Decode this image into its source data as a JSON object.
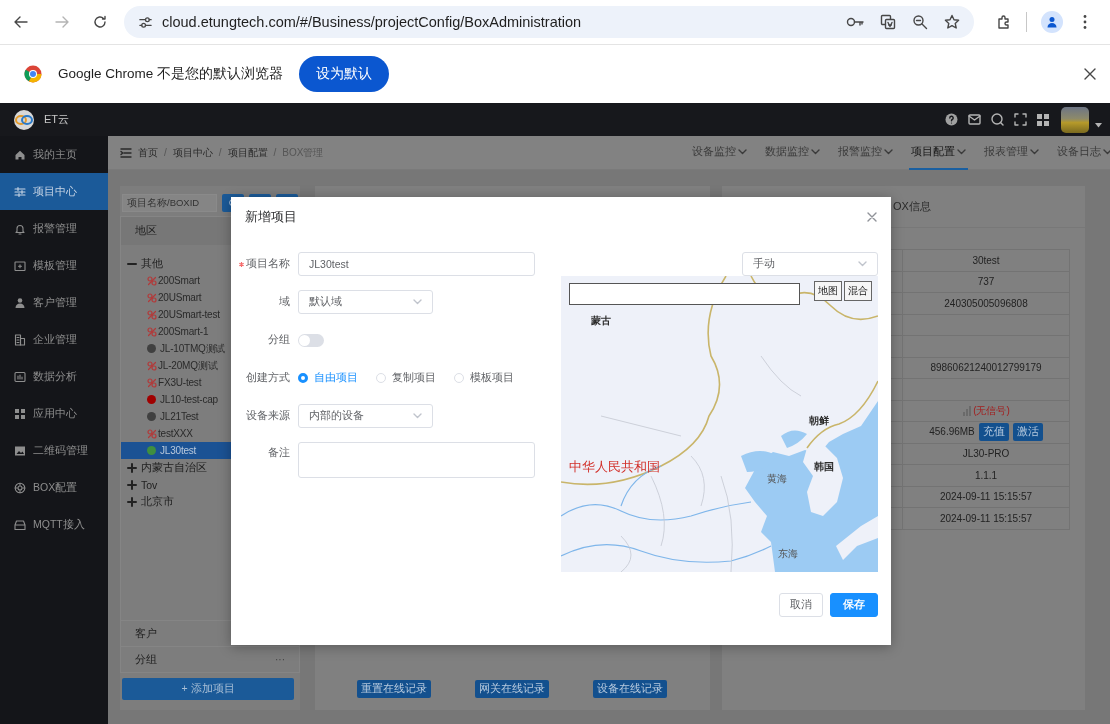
{
  "browser": {
    "url": "cloud.etungtech.com/#/Business/projectConfig/BoxAdministration",
    "forward_disabled": true
  },
  "infobar": {
    "message": "Google Chrome 不是您的默认浏览器",
    "button": "设为默认"
  },
  "app": {
    "logo_text": "ET云"
  },
  "sidebar": {
    "items": [
      {
        "label": "我的主页",
        "kind": "home",
        "selected": false
      },
      {
        "label": "项目中心",
        "kind": "sliders",
        "selected": true
      },
      {
        "label": "报警管理",
        "kind": "bell",
        "selected": false
      },
      {
        "label": "模板管理",
        "kind": "folder",
        "selected": false
      },
      {
        "label": "客户管理",
        "kind": "user",
        "selected": false
      },
      {
        "label": "企业管理",
        "kind": "building",
        "selected": false
      },
      {
        "label": "数据分析",
        "kind": "chart",
        "selected": false
      },
      {
        "label": "应用中心",
        "kind": "grid",
        "selected": false
      },
      {
        "label": "二维码管理",
        "kind": "image",
        "selected": false
      },
      {
        "label": "BOX配置",
        "kind": "gear",
        "selected": false
      },
      {
        "label": "MQTT接入",
        "kind": "tray",
        "selected": false
      }
    ]
  },
  "breadcrumb": {
    "separator": "/",
    "items": [
      "首页",
      "项目中心",
      "项目配置",
      "BOX管理"
    ]
  },
  "nav_tabs": [
    {
      "label": "设备监控",
      "selected": false
    },
    {
      "label": "数据监控",
      "selected": false
    },
    {
      "label": "报警监控",
      "selected": false
    },
    {
      "label": "项目配置",
      "selected": true
    },
    {
      "label": "报表管理",
      "selected": false
    },
    {
      "label": "设备日志",
      "selected": false
    }
  ],
  "tree_panel": {
    "search_placeholder": "项目名称/BOXID",
    "header": "地区",
    "tree": [
      {
        "label": "其他",
        "expanded": true,
        "selected": false,
        "children": [
          {
            "label": "200Smart",
            "kind": "link",
            "selected": false
          },
          {
            "label": "20USmart",
            "kind": "link",
            "selected": false
          },
          {
            "label": "20USmart-test",
            "kind": "link",
            "selected": false
          },
          {
            "label": "200Smart-1",
            "kind": "link",
            "selected": false
          },
          {
            "label": "JL-10TMQ测试",
            "kind": "dot",
            "color": "#404040",
            "selected": false
          },
          {
            "label": "JL-20MQ测试",
            "kind": "link",
            "selected": false
          },
          {
            "label": "FX3U-test",
            "kind": "link",
            "selected": false
          },
          {
            "label": "JL10-test-cap",
            "kind": "dot",
            "color": "#a00000",
            "selected": false
          },
          {
            "label": "JL21Test",
            "kind": "dot",
            "color": "#404040",
            "selected": false
          },
          {
            "label": "testXXX",
            "kind": "link",
            "selected": false
          },
          {
            "label": "JL30test",
            "kind": "dot",
            "color": "#3f8f3f",
            "selected": true
          }
        ]
      },
      {
        "label": "内蒙古自治区",
        "expanded": false,
        "selected": false
      },
      {
        "label": "Tov",
        "expanded": false,
        "selected": false
      },
      {
        "label": "北京市",
        "expanded": false,
        "selected": false
      }
    ],
    "footer_rows": [
      {
        "label": "客户"
      },
      {
        "label": "分组",
        "more": "···"
      }
    ],
    "add_button": "+ 添加项目"
  },
  "records_buttons": [
    "重置在线记录",
    "网关在线记录",
    "设备在线记录"
  ],
  "box_info": {
    "title": "OX信息",
    "rows": [
      {
        "kind": "text",
        "value": "30test"
      },
      {
        "kind": "text",
        "value": "737"
      },
      {
        "kind": "text",
        "value": "240305005096808"
      },
      {
        "kind": "empty"
      },
      {
        "kind": "empty"
      },
      {
        "kind": "text",
        "value": "89860621240012799179"
      },
      {
        "kind": "empty"
      },
      {
        "kind": "signal",
        "value": "(无信号)"
      },
      {
        "kind": "traffic",
        "value": "456.96MB",
        "buttons": [
          "充值",
          "激活"
        ]
      },
      {
        "kind": "text",
        "value": "JL30-PRO"
      },
      {
        "kind": "text",
        "value": "1.1.1"
      },
      {
        "kind": "text",
        "value": "2024-09-11 15:15:57"
      },
      {
        "kind": "text",
        "value": "2024-09-11 15:15:57"
      }
    ]
  },
  "dialog": {
    "title": "新增项目",
    "fields": [
      {
        "kind": "input",
        "label": "项目名称",
        "required": true,
        "value": "JL30test"
      },
      {
        "kind": "select",
        "label": "域",
        "required": false,
        "value": "默认域"
      },
      {
        "kind": "switch",
        "label": "分组",
        "required": false,
        "on": false
      },
      {
        "kind": "radio",
        "label": "创建方式",
        "required": false,
        "options": [
          {
            "label": "自由项目",
            "selected": true
          },
          {
            "label": "复制项目",
            "selected": false
          },
          {
            "label": "模板项目",
            "selected": false
          }
        ]
      },
      {
        "kind": "select",
        "label": "设备来源",
        "required": false,
        "value": "内部的设备"
      },
      {
        "kind": "textarea",
        "label": "备注",
        "required": false
      }
    ],
    "location_mode": "手动",
    "map": {
      "map_types": [
        "地图",
        "混合"
      ],
      "labels": [
        {
          "text": "蒙古",
          "kind": "country"
        },
        {
          "text": "朝鲜",
          "kind": "country"
        },
        {
          "text": "中华人民共和国",
          "kind": "china"
        },
        {
          "text": "韩国",
          "kind": "country"
        },
        {
          "text": "黄海",
          "kind": "sea"
        },
        {
          "text": "东海",
          "kind": "sea"
        }
      ]
    },
    "buttons": [
      {
        "label": "取消",
        "kind": "default"
      },
      {
        "label": "保存",
        "kind": "primary"
      }
    ]
  }
}
